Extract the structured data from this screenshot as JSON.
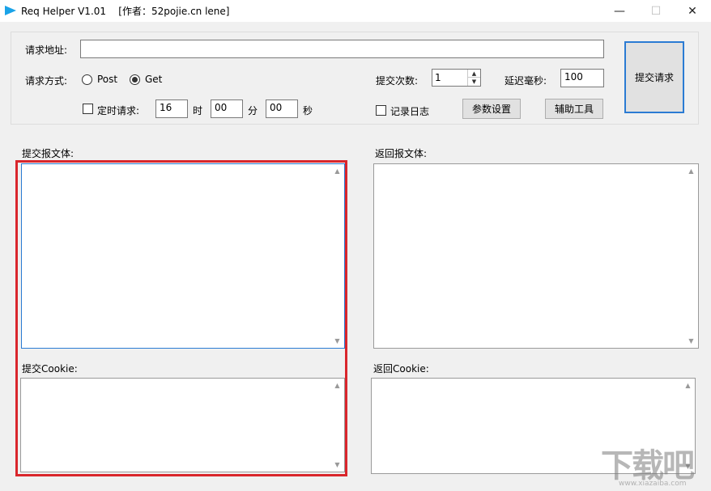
{
  "window": {
    "title": "Req Helper V1.01    [作者：52pojie.cn lene]",
    "minimize_glyph": "—",
    "maximize_glyph": "☐",
    "close_glyph": "✕"
  },
  "request": {
    "url_label": "请求地址:",
    "url_value": "",
    "method_label": "请求方式:",
    "post_label": "Post",
    "get_label": "Get",
    "selected_method": "Get",
    "submit_count_label": "提交次数:",
    "submit_count_value": "1",
    "delay_label": "延迟毫秒:",
    "delay_value": "100",
    "submit_button": "提交请求"
  },
  "timer": {
    "checkbox_label": "定时请求:",
    "checked": false,
    "hour_value": "16",
    "hour_unit": "时",
    "minute_value": "00",
    "minute_unit": "分",
    "second_value": "00",
    "second_unit": "秒"
  },
  "log": {
    "checkbox_label": "记录日志",
    "checked": false
  },
  "buttons": {
    "params": "参数设置",
    "tools": "辅助工具"
  },
  "panels": {
    "submit_body_label": "提交报文体:",
    "return_body_label": "返回报文体:",
    "submit_cookie_label": "提交Cookie:",
    "return_cookie_label": "返回Cookie:"
  },
  "watermark": {
    "text": "下载吧",
    "url": "www.xiazaiba.com"
  },
  "colors": {
    "highlight": "#d9262c",
    "accent": "#2b7bd3",
    "app_icon": "#1aa3e8"
  }
}
